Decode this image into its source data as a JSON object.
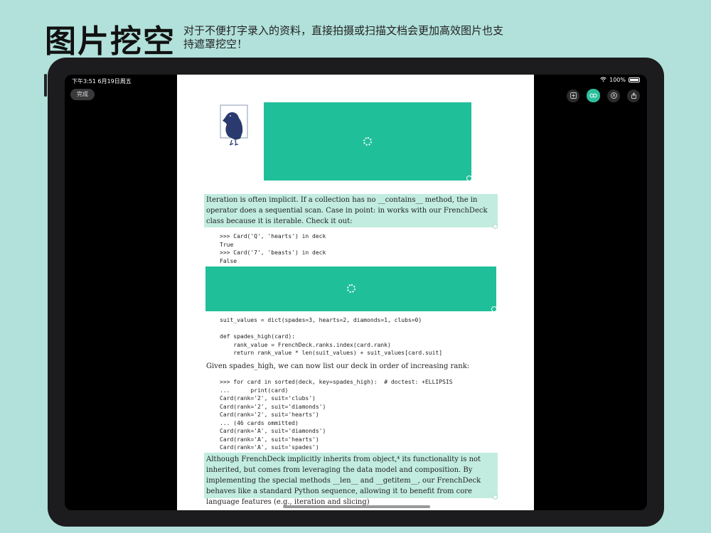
{
  "headline": "图片挖空",
  "subtitle": "对于不便打字录入的资料，直接拍摄或扫描文档会更加高效图片也支持遮罩挖空！",
  "status": {
    "time": "下午3:51  6月19日周五",
    "battery": "100%"
  },
  "toolbar": {
    "done_label": "完成"
  },
  "icons": {
    "add": "add-icon",
    "mask": "mask-toggle-icon",
    "pen": "pen-icon",
    "share": "share-icon"
  },
  "colors": {
    "accent": "#1fbf99",
    "highlight": "#c2ece0"
  },
  "document": {
    "para1": "Iteration is often implicit. If a collection has no __contains__ method, the in operator does a sequential scan. Case in point: in works with our FrenchDeck class because it is iterable. Check it out:",
    "code1": ">>> Card('Q', 'hearts') in deck\nTrue\n>>> Card('7', 'beasts') in deck\nFalse",
    "code2": "suit_values = dict(spades=3, hearts=2, diamonds=1, clubs=0)\n\ndef spades_high(card):\n    rank_value = FrenchDeck.ranks.index(card.rank)\n    return rank_value * len(suit_values) + suit_values[card.suit]",
    "para2": "Given spades_high, we can now list our deck in order of increasing rank:",
    "code3": ">>> for card in sorted(deck, key=spades_high):  # doctest: +ELLIPSIS\n...      print(card)\nCard(rank='2', suit='clubs')\nCard(rank='2', suit='diamonds')\nCard(rank='2', suit='hearts')\n... (46 cards ommitted)\nCard(rank='A', suit='diamonds')\nCard(rank='A', suit='hearts')\nCard(rank='A', suit='spades')",
    "para3": "Although FrenchDeck implicitly inherits from object,⁴ its functionality is not inherited, but comes from leveraging the data model and composition. By implementing the special methods __len__ and __getitem__, our FrenchDeck behaves like a standard Python sequence, allowing it to benefit from core language features (e.g., iteration and slicing)"
  }
}
